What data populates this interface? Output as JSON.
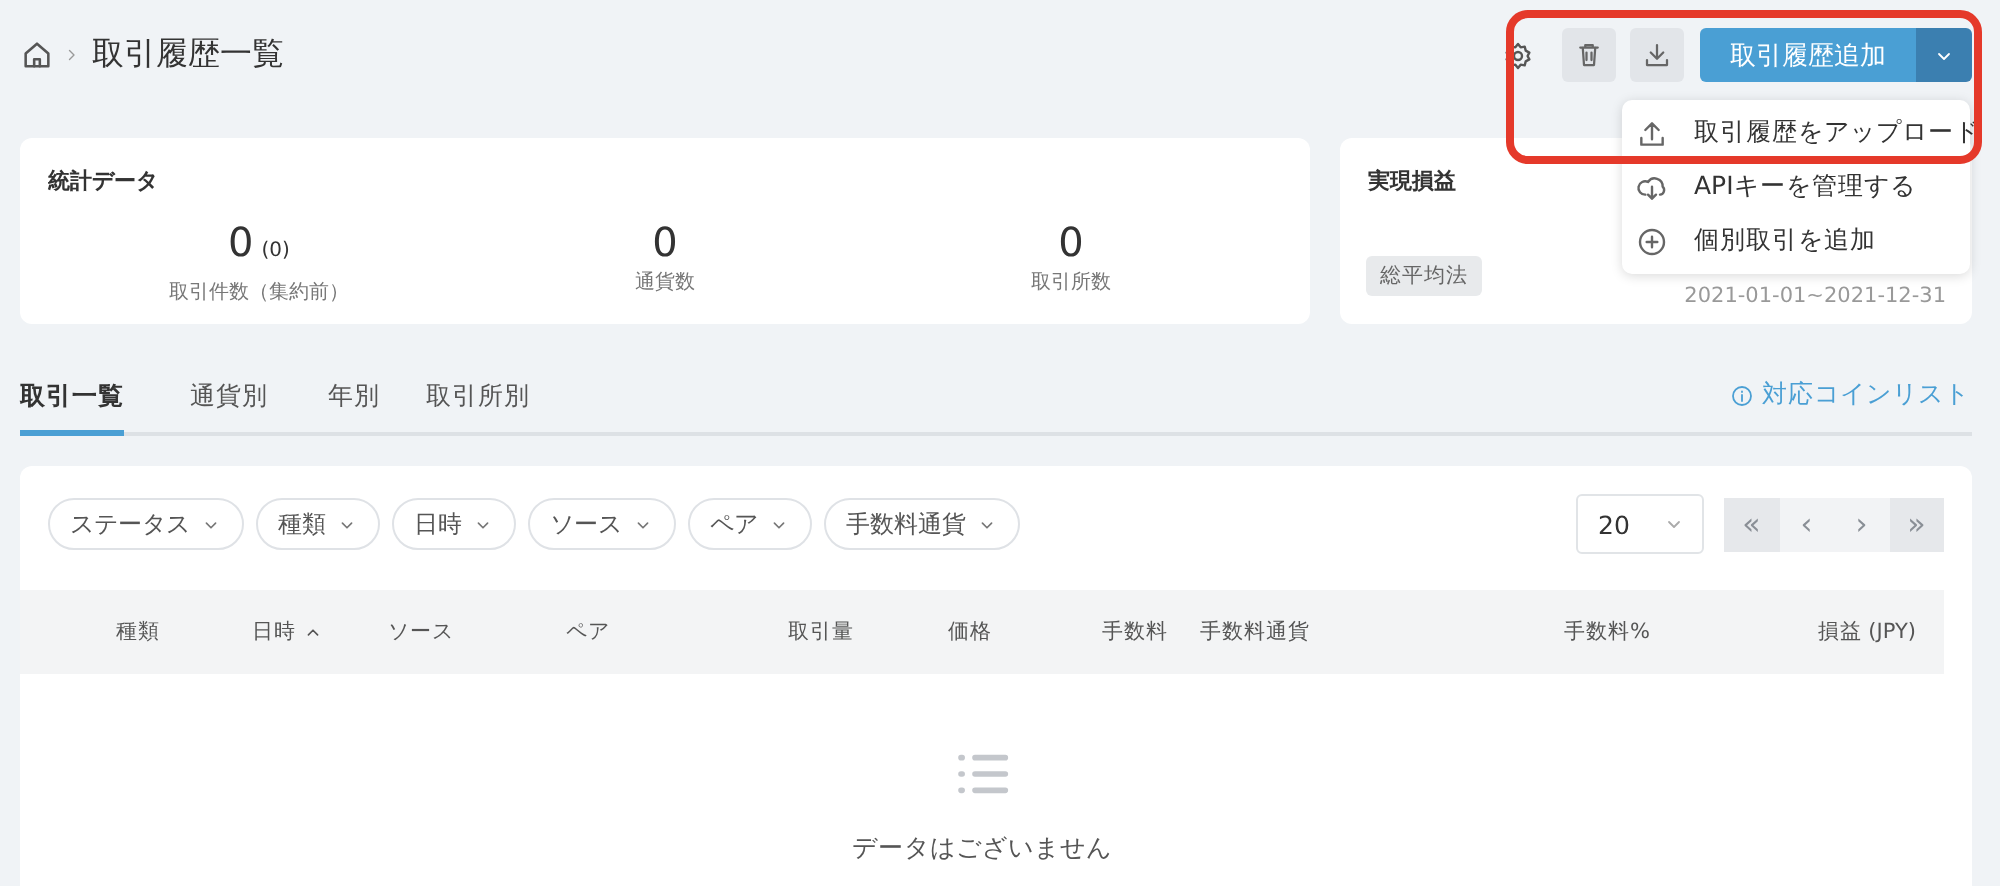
{
  "breadcrumb": {
    "title": "取引履歴一覧"
  },
  "toolbar": {
    "add_button": "取引履歴追加"
  },
  "dropdown_menu": {
    "items": [
      {
        "kind": "upload",
        "label": "取引履歴をアップロード"
      },
      {
        "kind": "cloud",
        "label": "APIキーを管理する"
      },
      {
        "kind": "add",
        "label": "個別取引を追加"
      }
    ]
  },
  "stats_card": {
    "title": "統計データ",
    "stats": [
      {
        "value": "0",
        "sub": "(0)",
        "label": "取引件数（集約前）"
      },
      {
        "value": "0",
        "label": "通貨数"
      },
      {
        "value": "0",
        "label": "取引所数"
      }
    ]
  },
  "pnl_card": {
    "title": "実現損益",
    "method_tag": "総平均法",
    "period": "2021-01-01~2021-12-31"
  },
  "tabs": [
    {
      "label": "取引一覧",
      "selected": true
    },
    {
      "label": "通貨別",
      "selected": false
    },
    {
      "label": "年別",
      "selected": false
    },
    {
      "label": "取引所別",
      "selected": false
    }
  ],
  "coin_list_link": "対応コインリスト",
  "filters": [
    "ステータス",
    "種類",
    "日時",
    "ソース",
    "ペア",
    "手数料通貨"
  ],
  "page_size": "20",
  "pagination": [
    "«",
    "‹",
    "›",
    "»"
  ],
  "table": {
    "columns": [
      {
        "label": "種類",
        "sorted": false
      },
      {
        "label": "日時",
        "sorted": true
      },
      {
        "label": "ソース",
        "sorted": false
      },
      {
        "label": "ペア",
        "sorted": false
      },
      {
        "label": "取引量",
        "sorted": false
      },
      {
        "label": "価格",
        "sorted": false
      },
      {
        "label": "手数料",
        "sorted": false
      },
      {
        "label": "手数料通貨",
        "sorted": false
      },
      {
        "label": "手数料%",
        "sorted": false
      },
      {
        "label": "損益 (JPY)",
        "sorted": false
      }
    ],
    "empty_text": "データはございません"
  }
}
